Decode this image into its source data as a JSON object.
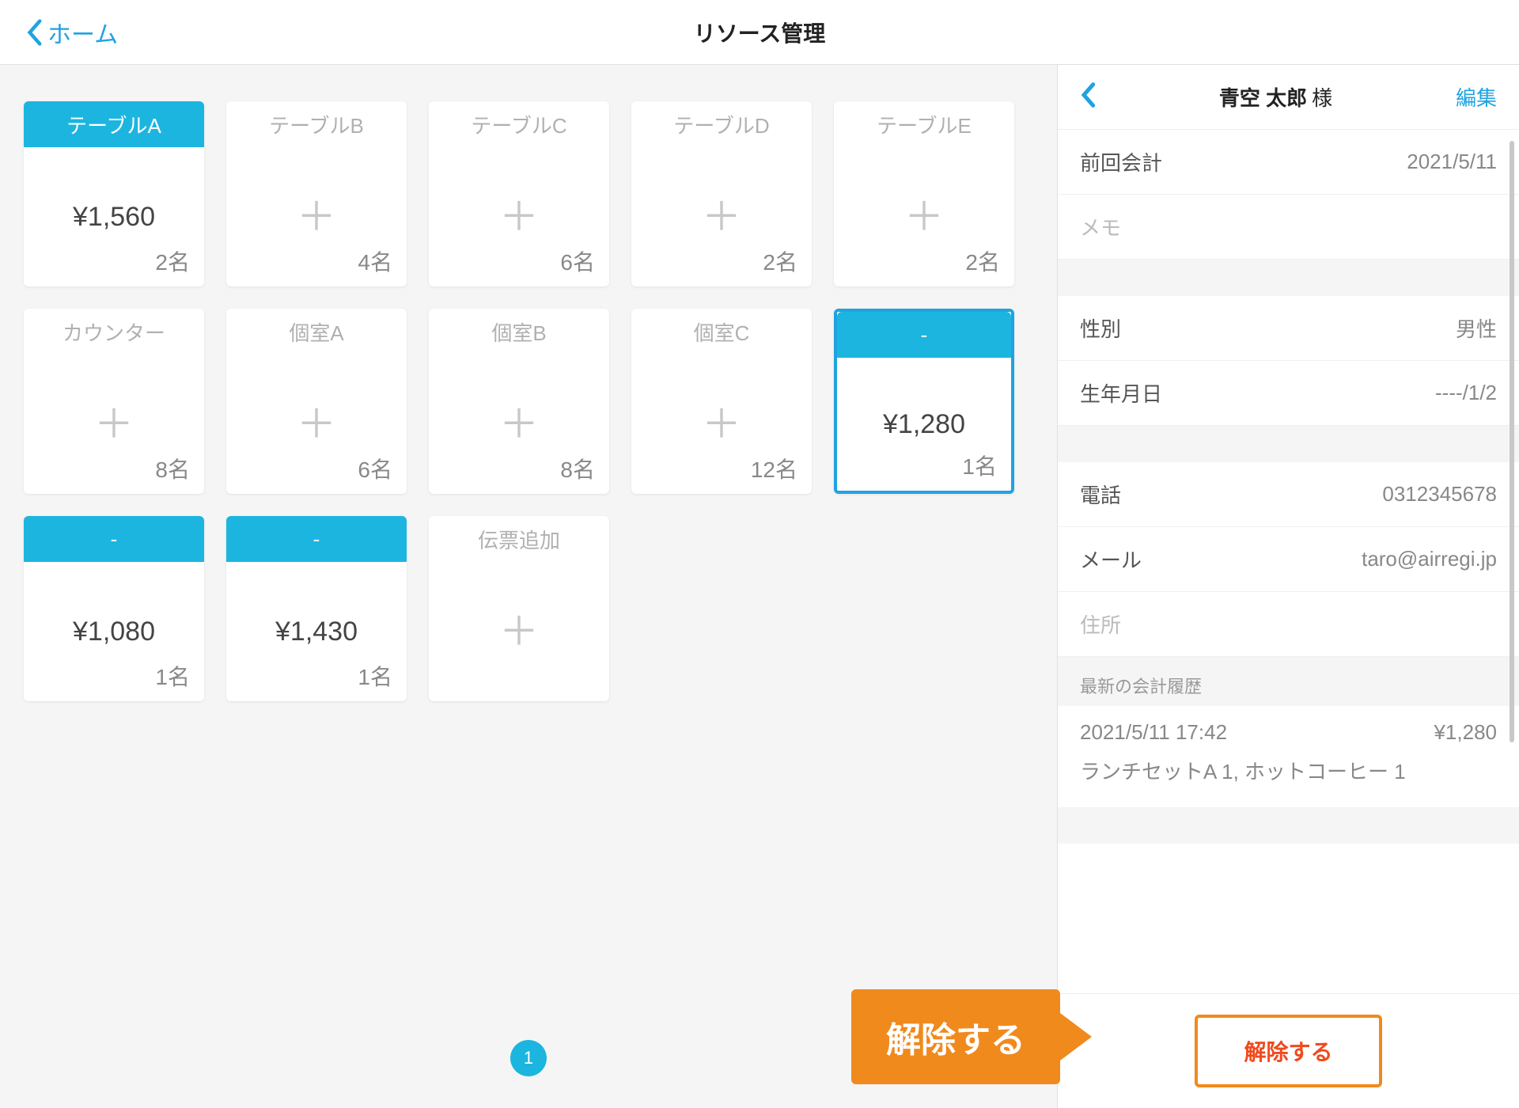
{
  "nav": {
    "back": "ホーム",
    "title": "リソース管理"
  },
  "tables": [
    {
      "name": "テーブルA",
      "active": true,
      "price": "¥1,560",
      "cap": "2名",
      "selected": false,
      "plus": false
    },
    {
      "name": "テーブルB",
      "active": false,
      "price": "",
      "cap": "4名",
      "selected": false,
      "plus": true
    },
    {
      "name": "テーブルC",
      "active": false,
      "price": "",
      "cap": "6名",
      "selected": false,
      "plus": true
    },
    {
      "name": "テーブルD",
      "active": false,
      "price": "",
      "cap": "2名",
      "selected": false,
      "plus": true
    },
    {
      "name": "テーブルE",
      "active": false,
      "price": "",
      "cap": "2名",
      "selected": false,
      "plus": true
    },
    {
      "name": "カウンター",
      "active": false,
      "price": "",
      "cap": "8名",
      "selected": false,
      "plus": true
    },
    {
      "name": "個室A",
      "active": false,
      "price": "",
      "cap": "6名",
      "selected": false,
      "plus": true
    },
    {
      "name": "個室B",
      "active": false,
      "price": "",
      "cap": "8名",
      "selected": false,
      "plus": true
    },
    {
      "name": "個室C",
      "active": false,
      "price": "",
      "cap": "12名",
      "selected": false,
      "plus": true
    },
    {
      "name": "-",
      "active": true,
      "price": "¥1,280",
      "cap": "1名",
      "selected": true,
      "plus": false
    },
    {
      "name": "-",
      "active": true,
      "price": "¥1,080",
      "cap": "1名",
      "selected": false,
      "plus": false
    },
    {
      "name": "-",
      "active": true,
      "price": "¥1,430",
      "cap": "1名",
      "selected": false,
      "plus": false
    }
  ],
  "addslip": "伝票追加",
  "page": "1",
  "panel": {
    "customer_name": "青空 太郎",
    "suffix": "様",
    "edit": "編集",
    "rows": {
      "last_label": "前回会計",
      "last_value": "2021/5/11",
      "memo_label": "メモ",
      "gender_label": "性別",
      "gender_value": "男性",
      "dob_label": "生年月日",
      "dob_value": "----/1/2",
      "phone_label": "電話",
      "phone_value": "0312345678",
      "mail_label": "メール",
      "mail_value": "taro@airregi.jp",
      "addr_label": "住所"
    },
    "history_title": "最新の会計履歴",
    "history_time": "2021/5/11 17:42",
    "history_amount": "¥1,280",
    "history_items": "ランチセットA 1, ホットコーヒー 1",
    "release": "解除する"
  },
  "callout": "解除する"
}
